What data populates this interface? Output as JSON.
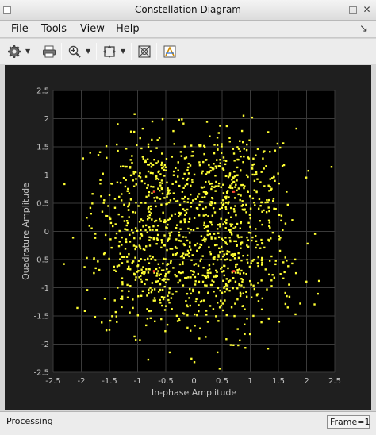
{
  "window": {
    "title": "Constellation Diagram"
  },
  "menu": {
    "file": {
      "first": "F",
      "rest": "ile"
    },
    "tools": {
      "first": "T",
      "rest": "ools"
    },
    "view": {
      "first": "V",
      "rest": "iew"
    },
    "help": {
      "first": "H",
      "rest": "elp"
    }
  },
  "toolbar": {
    "icons": [
      "gear-icon",
      "print-icon",
      "zoom-in-icon",
      "fit-to-view-icon",
      "scatter-point-icon",
      "legend-icon"
    ]
  },
  "chart_data": {
    "type": "scatter",
    "xlabel": "In-phase Amplitude",
    "ylabel": "Quadrature Amplitude",
    "xlim": [
      -2.5,
      2.5
    ],
    "ylim": [
      -2.5,
      2.5
    ],
    "xticks": [
      "-2.5",
      "-2",
      "-1.5",
      "-1",
      "-0.5",
      "0",
      "0.5",
      "1",
      "1.5",
      "2",
      "2.5"
    ],
    "yticks": [
      "2.5",
      "2",
      "1.5",
      "1",
      "0.5",
      "0",
      "-0.5",
      "-1",
      "-1.5",
      "-2",
      "-2.5"
    ],
    "grid": true,
    "background_color": "#000000",
    "point_color": "#ffff33",
    "reference_color": "#ff3b30",
    "reference_points": [
      {
        "x": -0.707,
        "y": 0.707
      },
      {
        "x": 0.707,
        "y": 0.707
      },
      {
        "x": -0.707,
        "y": -0.707
      },
      {
        "x": 0.707,
        "y": -0.707
      }
    ],
    "noise_clusters": [
      {
        "cx": -0.707,
        "cy": 0.707,
        "sigma": 0.55,
        "count": 320
      },
      {
        "cx": 0.707,
        "cy": 0.707,
        "sigma": 0.55,
        "count": 320
      },
      {
        "cx": -0.707,
        "cy": -0.707,
        "sigma": 0.55,
        "count": 320
      },
      {
        "cx": 0.707,
        "cy": -0.707,
        "sigma": 0.55,
        "count": 320
      }
    ]
  },
  "status": {
    "text": "Processing",
    "frame": "Frame=1"
  }
}
